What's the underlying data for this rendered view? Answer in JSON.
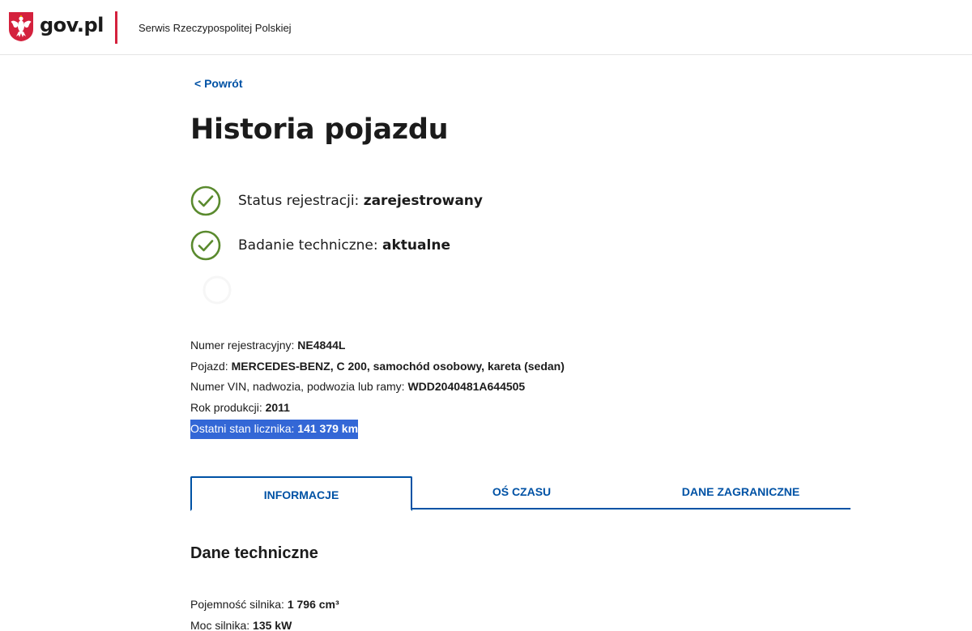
{
  "header": {
    "logo_text": "gov.pl",
    "service_name": "Serwis Rzeczypospolitej Polskiej"
  },
  "back_link": "< Powrót",
  "page_title": "Historia pojazdu",
  "statuses": [
    {
      "label": "Status rejestracji:",
      "value": "zarejestrowany"
    },
    {
      "label": "Badanie techniczne:",
      "value": "aktualne"
    }
  ],
  "vehicle": {
    "registration": {
      "label": "Numer rejestracyjny:",
      "value": "NE4844L"
    },
    "vehicle": {
      "label": "Pojazd:",
      "value": "MERCEDES-BENZ, C 200, samochód osobowy, kareta (sedan)"
    },
    "vin": {
      "label": "Numer VIN, nadwozia, podwozia lub ramy:",
      "value": "WDD2040481A644505"
    },
    "year": {
      "label": "Rok produkcji:",
      "value": "2011"
    },
    "odometer": {
      "label": "Ostatni stan licznika:",
      "value": "141 379 km"
    }
  },
  "tabs": [
    "INFORMACJE",
    "OŚ CZASU",
    "DANE ZAGRANICZNE"
  ],
  "active_tab": "INFORMACJE",
  "technical": {
    "title": "Dane techniczne",
    "engine_capacity": {
      "label": "Pojemność silnika:",
      "value": "1 796 cm³"
    },
    "engine_power": {
      "label": "Moc silnika:",
      "value": "135 kW"
    }
  },
  "colors": {
    "accent": "#0052a5",
    "check_green": "#5a8a2e",
    "brand_red": "#d4213d",
    "selection": "#3367d6"
  }
}
